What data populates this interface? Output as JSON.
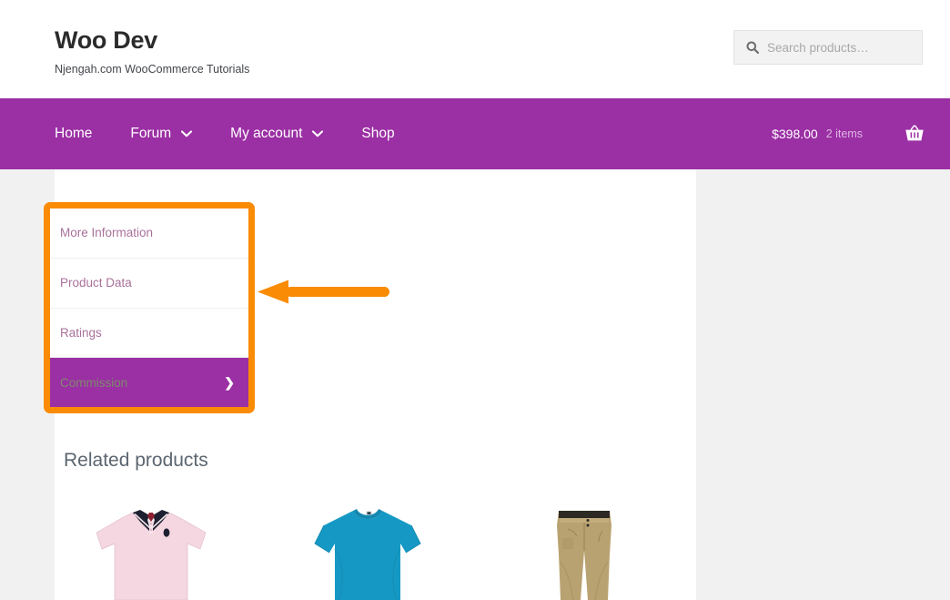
{
  "header": {
    "site_title": "Woo Dev",
    "tagline": "Njengah.com WooCommerce Tutorials",
    "search": {
      "icon": "search-icon",
      "placeholder": "Search products…",
      "value": ""
    }
  },
  "nav": {
    "items": [
      {
        "label": "Home",
        "has_dropdown": false
      },
      {
        "label": "Forum",
        "has_dropdown": true
      },
      {
        "label": "My account",
        "has_dropdown": true
      },
      {
        "label": "Shop",
        "has_dropdown": false
      }
    ],
    "cart": {
      "amount": "$398.00",
      "count": "2 items",
      "icon": "shopping-basket-icon"
    },
    "background_color": "#9b2fa4"
  },
  "product_tabs": {
    "items": [
      {
        "label": "More Information",
        "active": false
      },
      {
        "label": "Product Data",
        "active": false
      },
      {
        "label": "Ratings",
        "active": false
      },
      {
        "label": "Commission",
        "active": true,
        "chevron": "❯"
      }
    ],
    "active_background": "#9b2fa4",
    "link_color": "#a8719a",
    "highlight_color": "#fa8b05"
  },
  "annotation": {
    "type": "arrow-left",
    "color": "#fa8b05"
  },
  "related": {
    "heading": "Related products",
    "products": [
      {
        "name": "pink-polo-shirt",
        "color": "#f4d7e0"
      },
      {
        "name": "blue-t-shirt",
        "color": "#1599c4"
      },
      {
        "name": "khaki-pants",
        "color": "#b9a271"
      }
    ]
  },
  "colors": {
    "brand_purple": "#9b2fa4",
    "annotation_orange": "#fa8b05",
    "page_background": "#f1f1f1",
    "content_background": "#ffffff"
  }
}
